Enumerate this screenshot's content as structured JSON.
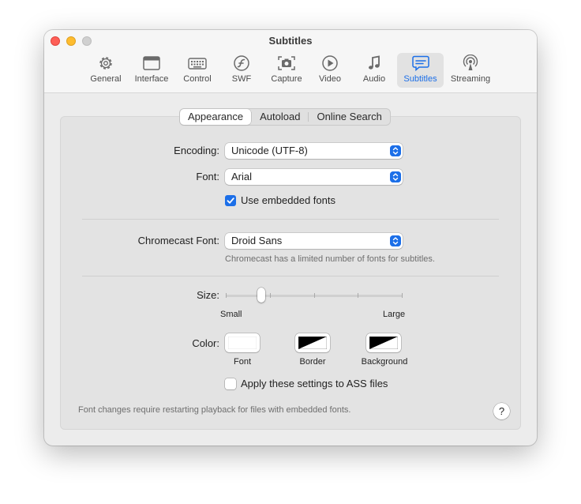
{
  "window": {
    "title": "Subtitles"
  },
  "toolbar": {
    "items": [
      {
        "label": "General",
        "icon": "gear-icon"
      },
      {
        "label": "Interface",
        "icon": "window-icon"
      },
      {
        "label": "Control",
        "icon": "keyboard-icon"
      },
      {
        "label": "SWF",
        "icon": "flash-icon"
      },
      {
        "label": "Capture",
        "icon": "camera-icon"
      },
      {
        "label": "Video",
        "icon": "play-icon"
      },
      {
        "label": "Audio",
        "icon": "music-note-icon"
      },
      {
        "label": "Subtitles",
        "icon": "subtitles-bubble-icon",
        "selected": true
      },
      {
        "label": "Streaming",
        "icon": "broadcast-icon"
      }
    ]
  },
  "tabs": [
    {
      "label": "Appearance",
      "selected": true
    },
    {
      "label": "Autoload",
      "selected": false
    },
    {
      "label": "Online Search",
      "selected": false
    }
  ],
  "form": {
    "encoding": {
      "label": "Encoding:",
      "value": "Unicode (UTF-8)"
    },
    "font": {
      "label": "Font:",
      "value": "Arial"
    },
    "embedded": {
      "label": "Use embedded fonts",
      "checked": true
    },
    "chromecast": {
      "label": "Chromecast Font:",
      "value": "Droid Sans",
      "note": "Chromecast has a limited number of fonts for subtitles."
    },
    "size": {
      "label": "Size:",
      "min_label": "Small",
      "max_label": "Large",
      "value_fraction": 0.2,
      "steps": 5
    },
    "color": {
      "label": "Color:",
      "swatches": [
        {
          "label": "Font",
          "color": "#ffffff"
        },
        {
          "label": "Border",
          "color": "#000000"
        },
        {
          "label": "Background",
          "color": "#000000"
        }
      ]
    },
    "ass": {
      "label": "Apply these settings to ASS files",
      "checked": false
    },
    "footer_note": "Font changes require restarting playback for files with embedded fonts.",
    "help": "?"
  },
  "colors": {
    "accent": "#1c6fe8",
    "close": "#fe5f57",
    "minimize": "#febc2e",
    "zoom_disabled": "#d0d0d0"
  }
}
